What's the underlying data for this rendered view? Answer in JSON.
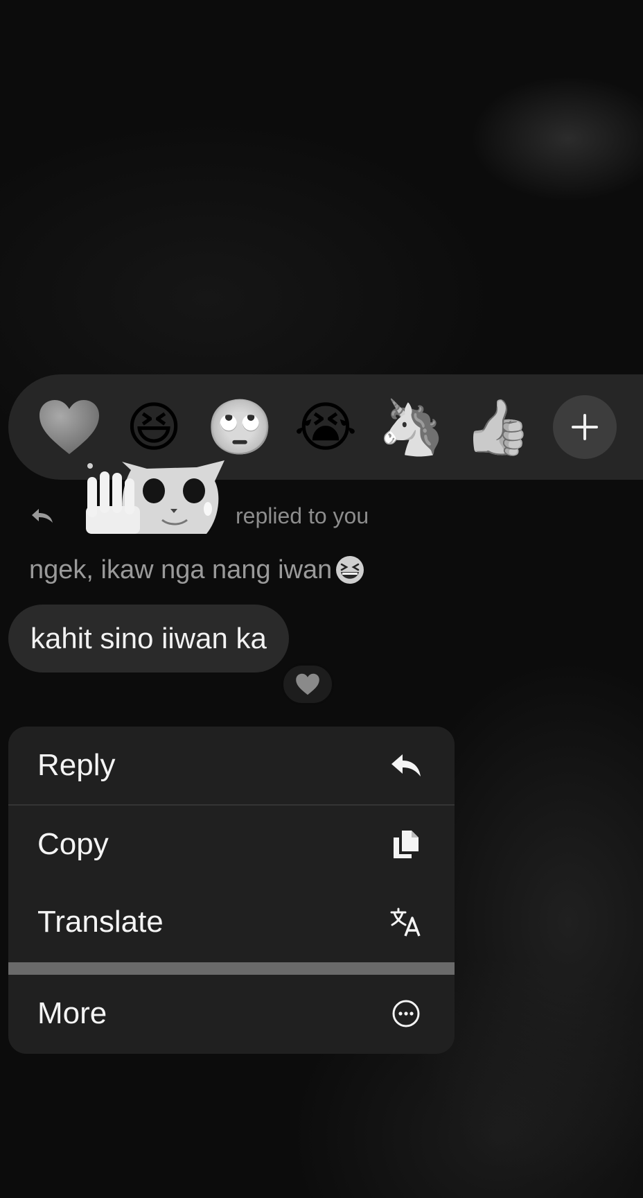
{
  "reactions": [
    {
      "name": "heart",
      "glyph": "❤️"
    },
    {
      "name": "laughing",
      "glyph": "😆"
    },
    {
      "name": "eye-roll",
      "glyph": "🙄"
    },
    {
      "name": "crying",
      "glyph": "😭"
    },
    {
      "name": "unicorn",
      "glyph": "🦄"
    },
    {
      "name": "thumbs-up",
      "glyph": "👍"
    }
  ],
  "add_reaction_icon": "plus-icon",
  "reply_header": {
    "text": "replied to you",
    "icon": "reply-arrow-icon",
    "sticker": "crying-cat-waving-sticker"
  },
  "quoted_message": {
    "text": "ngek, ikaw nga nang iwan",
    "emoji": "laughing-emoji"
  },
  "message": {
    "text": "kahit sino iiwan ka",
    "reaction": "heart-icon"
  },
  "menu": {
    "items": [
      {
        "label": "Reply",
        "icon": "reply-icon"
      },
      {
        "label": "Copy",
        "icon": "copy-icon"
      },
      {
        "label": "Translate",
        "icon": "translate-icon"
      },
      {
        "label": "More",
        "icon": "more-icon"
      }
    ]
  },
  "colors": {
    "background": "#0c0c0c",
    "reaction_bar": "#262626",
    "bubble": "#2a2a2a",
    "menu": "#202020",
    "text_primary": "#f2f2f2",
    "text_secondary": "#9a9a9a"
  }
}
